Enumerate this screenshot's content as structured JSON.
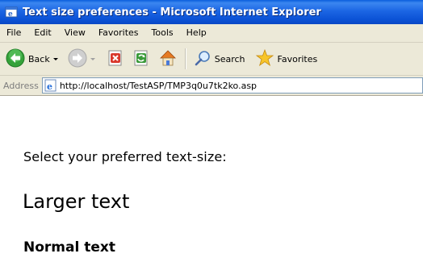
{
  "window": {
    "title": "Text size preferences - Microsoft Internet Explorer"
  },
  "menubar": {
    "items": [
      "File",
      "Edit",
      "View",
      "Favorites",
      "Tools",
      "Help"
    ]
  },
  "toolbar": {
    "back_label": "Back",
    "search_label": "Search",
    "favorites_label": "Favorites"
  },
  "address": {
    "label": "Address",
    "url": "http://localhost/TestASP/TMP3q0u7tk2ko.asp"
  },
  "content": {
    "prompt": "Select your preferred text-size:",
    "larger_text": "Larger text",
    "normal_text": "Normal text"
  },
  "colors": {
    "titlebar_blue": "#0b52d6",
    "chrome_beige": "#ece9d8",
    "back_green": "#35a23a",
    "stop_red": "#d9382c"
  },
  "icons": {
    "title": "ie-window-icon",
    "back": "back-arrow-icon",
    "forward": "forward-arrow-icon",
    "stop": "stop-icon",
    "refresh": "refresh-icon",
    "home": "home-icon",
    "search": "search-icon",
    "favorites": "favorites-star-icon",
    "address_page": "ie-page-icon"
  }
}
